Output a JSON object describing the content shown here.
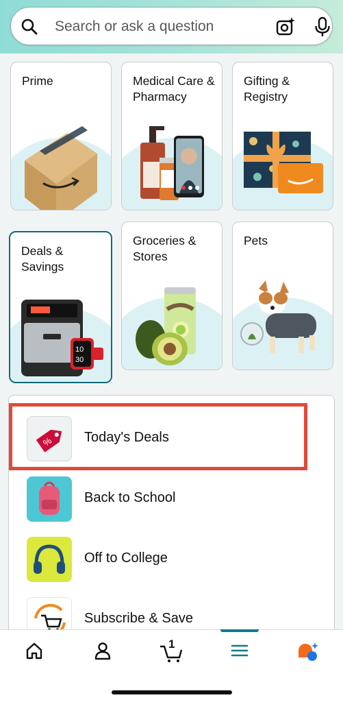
{
  "search": {
    "placeholder": "Search or ask a question",
    "icons": [
      "search-icon",
      "camera-sparkle-icon",
      "microphone-icon"
    ]
  },
  "tiles": [
    {
      "label": "Prime"
    },
    {
      "label": "Medical Care & Pharmacy"
    },
    {
      "label": "Gifting & Registry"
    },
    {
      "label": "Deals & Savings",
      "selected": true
    },
    {
      "label": "Groceries & Stores"
    },
    {
      "label": "Pets"
    }
  ],
  "deals_products": {
    "watch_time_top": "10",
    "watch_time_bottom": "30"
  },
  "list": [
    {
      "label": "Today's Deals",
      "icon": "tag-percent-icon",
      "highlighted": true
    },
    {
      "label": "Back to School",
      "icon": "backpack-icon"
    },
    {
      "label": "Off to College",
      "icon": "headphones-icon"
    },
    {
      "label": "Subscribe & Save",
      "icon": "cart-refresh-icon"
    }
  ],
  "tabbar": {
    "cart_count": "1",
    "tabs": [
      "home-icon",
      "account-icon",
      "cart-icon",
      "menu-icon",
      "rufus-chat-icon"
    ],
    "active": "menu-icon"
  },
  "colors": {
    "accent": "#0f7b8a",
    "highlight_border": "#e04a3a",
    "header_gradient_start": "#8fdcd6",
    "header_gradient_end": "#c4ecd9"
  }
}
